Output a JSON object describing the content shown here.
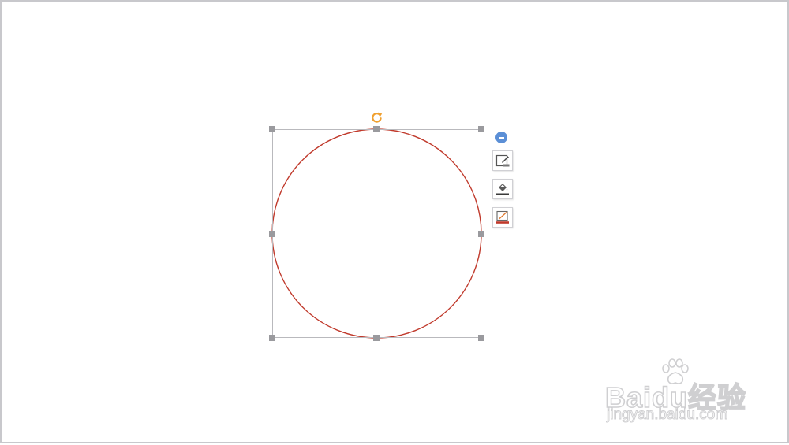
{
  "canvas": {
    "background": "#ffffff",
    "border_color": "#c8c8cc"
  },
  "shape": {
    "type": "circle",
    "outline_color": "#c0392b",
    "fill": "none"
  },
  "selection": {
    "frame_color": "#b9b9bd",
    "handle_color": "#9a9a9e",
    "rotate_handle_color": "#f0a030",
    "rotate_icon": "rotate-icon"
  },
  "side_toolbar": {
    "collapse_icon": "minus-circle-icon",
    "collapse_color": "#5b8fd6",
    "tools": [
      {
        "icon": "shape-style-icon"
      },
      {
        "icon": "fill-bucket-icon"
      },
      {
        "icon": "outline-pen-icon",
        "accent": "#c0392b"
      }
    ]
  },
  "watermark": {
    "brand": "Baidu经验",
    "url": "jingyan.baidu.com",
    "icon": "paw-icon",
    "color": "#a9a9ad"
  }
}
